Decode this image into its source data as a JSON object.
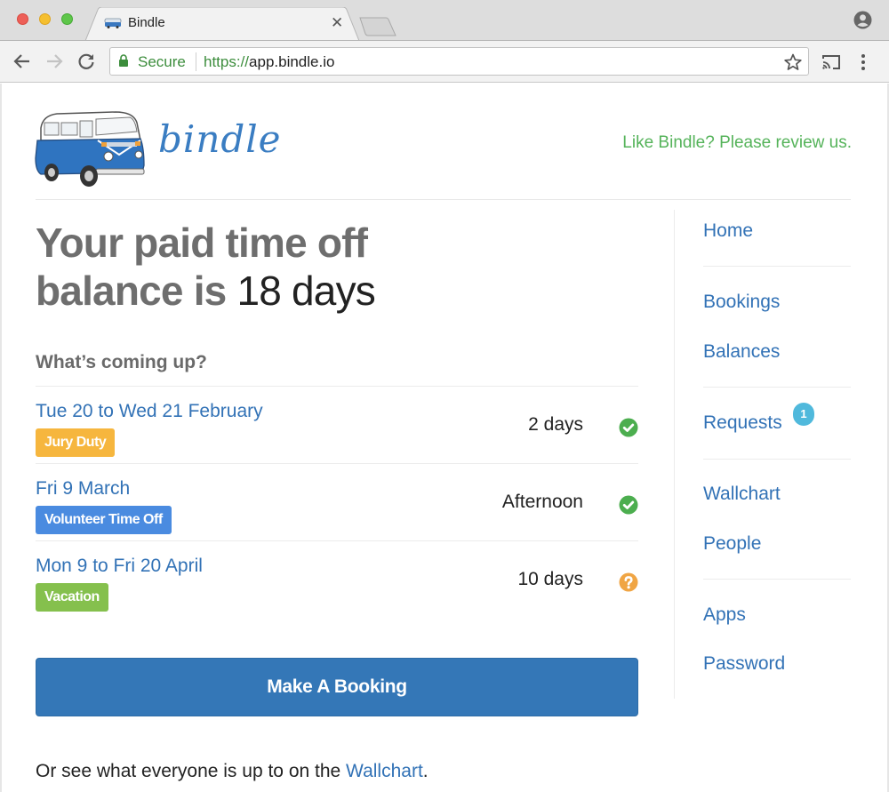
{
  "browser": {
    "tab_title": "Bindle",
    "secure_label": "Secure",
    "url_scheme": "https://",
    "url_host": "app.bindle.io"
  },
  "header": {
    "logo_text": "bindle",
    "review_link": "Like Bindle? Please review us."
  },
  "balance": {
    "prefix_line1": "Your paid time off",
    "prefix_line2": "balance is",
    "value": "18 days"
  },
  "upcoming": {
    "heading": "What’s coming up?",
    "bookings": [
      {
        "dates": "Tue 20 to Wed 21 February",
        "tag": "Jury Duty",
        "tag_color": "#f6b63e",
        "amount": "2 days",
        "status": "approved",
        "status_icon": "check-circle-icon",
        "status_color": "#4cae4f"
      },
      {
        "dates": "Fri 9 March",
        "tag": "Volunteer Time Off",
        "tag_color": "#4a8be0",
        "amount": "Afternoon",
        "status": "approved",
        "status_icon": "check-circle-icon",
        "status_color": "#4cae4f"
      },
      {
        "dates": "Mon 9 to Fri 20 April",
        "tag": "Vacation",
        "tag_color": "#85c04d",
        "amount": "10 days",
        "status": "pending",
        "status_icon": "question-circle-icon",
        "status_color": "#f0a544"
      }
    ]
  },
  "actions": {
    "make_booking": "Make A Booking"
  },
  "footer": {
    "note_prefix": "Or see what everyone is up to on the ",
    "note_link": "Wallchart",
    "note_suffix": "."
  },
  "sidebar": {
    "items": [
      {
        "label": "Home"
      },
      {
        "label": "Bookings"
      },
      {
        "label": "Balances"
      },
      {
        "label": "Requests",
        "badge": "1"
      },
      {
        "label": "Wallchart"
      },
      {
        "label": "People"
      },
      {
        "label": "Apps"
      },
      {
        "label": "Password"
      }
    ]
  },
  "colors": {
    "link": "#3272b6",
    "primary_button": "#3477b7",
    "review_green": "#55b35a",
    "badge": "#50b9dc"
  }
}
